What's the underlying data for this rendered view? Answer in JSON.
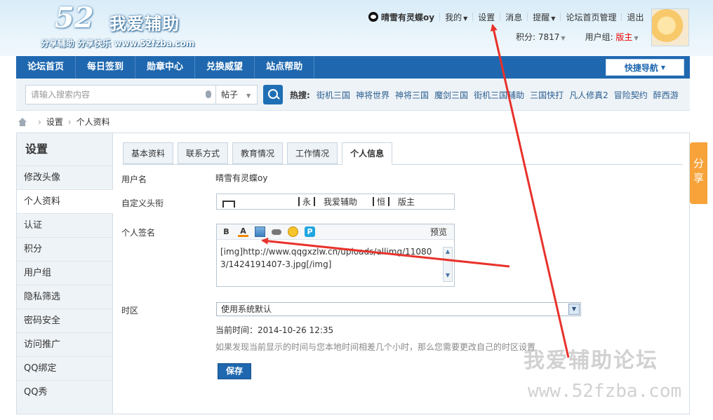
{
  "header": {
    "logo_num": "52",
    "logo_text": "我爱辅助",
    "logo_sub": "分享辅助  分享快乐  www.52fzba.com",
    "user_name": "晴雪有灵蝶oy",
    "links": [
      "我的",
      "设置",
      "消息",
      "提醒",
      "论坛首页管理",
      "退出"
    ],
    "points_label": "积分: 7817",
    "group_label": "用户组: ",
    "group_value": "版主"
  },
  "nav": {
    "items": [
      "论坛首页",
      "每日签到",
      "勋章中心",
      "兑换威望",
      "站点帮助"
    ],
    "quick_nav": "快捷导航"
  },
  "search": {
    "placeholder": "请输入搜索内容",
    "type": "帖子",
    "hot_label": "热搜:",
    "hot_items": [
      "街机三国",
      "神将世界",
      "神将三国",
      "魔剑三国",
      "街机三国辅助",
      "三国快打",
      "凡人修真2",
      "冒险契约",
      "醉西游"
    ]
  },
  "breadcrumb": {
    "items": [
      "设置",
      "个人资料"
    ]
  },
  "sidebar": {
    "title": "设置",
    "items": [
      "修改头像",
      "个人资料",
      "认证",
      "积分",
      "用户组",
      "隐私筛选",
      "密码安全",
      "访问推广",
      "QQ绑定",
      "QQ秀"
    ],
    "active_index": 1
  },
  "tabs": {
    "items": [
      "基本资料",
      "联系方式",
      "教育情况",
      "工作情况",
      "个人信息"
    ],
    "active_index": 4
  },
  "form": {
    "username_label": "用户名",
    "username_value": "晴雪有灵蝶oy",
    "title_label": "自定义头衔",
    "title_parts": [
      "永",
      "我爱辅助",
      "恒",
      "版主"
    ],
    "signature_label": "个人签名",
    "toolbar_bold": "B",
    "toolbar_color": "A",
    "toolbar_p": "P",
    "preview_label": "预览",
    "signature_text": "[img]http://www.qqgxzlw.cn/uploads/allimg/110803/1424191407-3.jpg[/img]",
    "timezone_label": "时区",
    "timezone_value": "使用系统默认",
    "current_time": "当前时间：2014-10-26 12:35",
    "timezone_hint": "如果发现当前显示的时间与您本地时间相差几个小时，那么您需要更改自己的时区设置",
    "save_label": "保存"
  },
  "share_tab": "分享",
  "watermark": {
    "title": "我爱辅助论坛",
    "url": "www.52fzba.com"
  },
  "colors": {
    "nav_blue": "#1f68b0",
    "share_orange": "#f7a33a",
    "arrow_red": "#e8322b"
  }
}
